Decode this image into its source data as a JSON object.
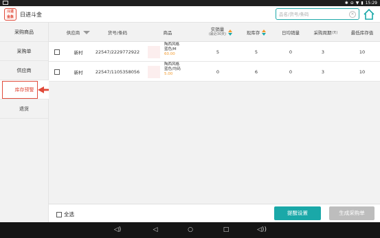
{
  "status_bar": {
    "time": "15:29"
  },
  "app": {
    "logo_text": [
      "斗进",
      "金象"
    ],
    "title": "日进斗金",
    "search_placeholder": "品名/货号/条码"
  },
  "sidebar": {
    "items": [
      {
        "label": "采购商品"
      },
      {
        "label": "采购单"
      },
      {
        "label": "供应商"
      },
      {
        "label": "库存预警"
      },
      {
        "label": "退货"
      }
    ],
    "active_index": 3
  },
  "table": {
    "headers": {
      "supplier": "供应商",
      "sku": "货号/条码",
      "product": "商品",
      "sales_line1": "实销量",
      "sales_line2": "(最近30天)",
      "stock": "现库存",
      "daily": "日均销量",
      "cycle": "采购周期",
      "cycle_unit": "(天)",
      "min_stock": "最低库存值"
    },
    "rows": [
      {
        "supplier": "新村",
        "sku": "22547/2229772922",
        "product_name": "陶西风格",
        "product_spec": "蓝色/M",
        "product_price": "60.00",
        "sales": "5",
        "stock": "5",
        "daily": "0",
        "cycle": "3",
        "min_stock": "10"
      },
      {
        "supplier": "新村",
        "sku": "22547/1105358056",
        "product_name": "陶西风格",
        "product_spec": "蓝色/均码",
        "product_price": "5.00",
        "sales": "0",
        "stock": "6",
        "daily": "0",
        "cycle": "3",
        "min_stock": "10"
      }
    ]
  },
  "footer": {
    "select_all": "全选",
    "remind_button": "提醒设置",
    "generate_button": "生成采购单"
  },
  "colors": {
    "accent": "#1aa8a8",
    "highlight": "#e04a3a",
    "price": "#f39a2b"
  }
}
